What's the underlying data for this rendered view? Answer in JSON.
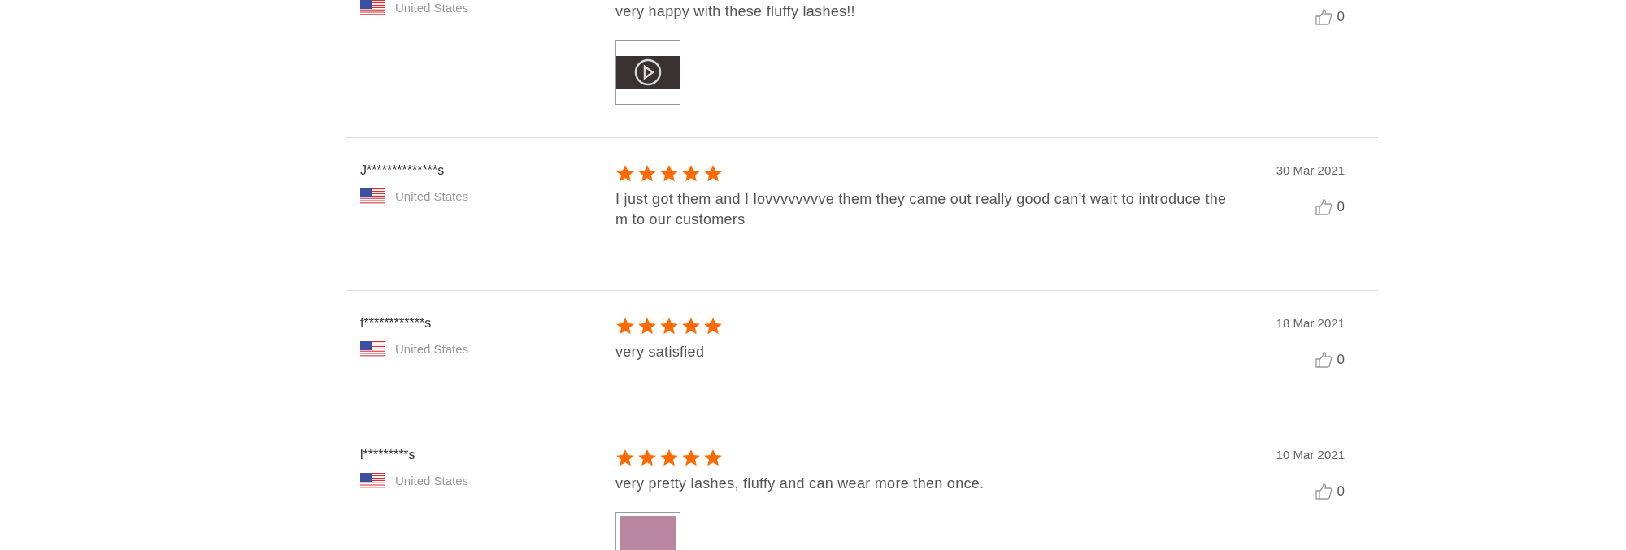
{
  "reviews": [
    {
      "country": "United States",
      "text": "very happy with these fluffy lashes!!",
      "likes": "0",
      "media": {
        "kind": "video"
      }
    },
    {
      "name": "J**************s",
      "country": "United States",
      "stars": 5,
      "date": "30 Mar 2021",
      "text": "I just got them and I lovvvvvvvve them they came out really good can't wait to introduce them to our customers",
      "likes": "0"
    },
    {
      "name": "f************s",
      "country": "United States",
      "stars": 5,
      "date": "18 Mar 2021",
      "text": "very satisfied",
      "likes": "0"
    },
    {
      "name": "l*********s",
      "country": "United States",
      "stars": 5,
      "date": "10 Mar 2021",
      "text": "very pretty lashes, fluffy and can wear more then once.",
      "likes": "0",
      "media": {
        "kind": "photo"
      }
    }
  ]
}
